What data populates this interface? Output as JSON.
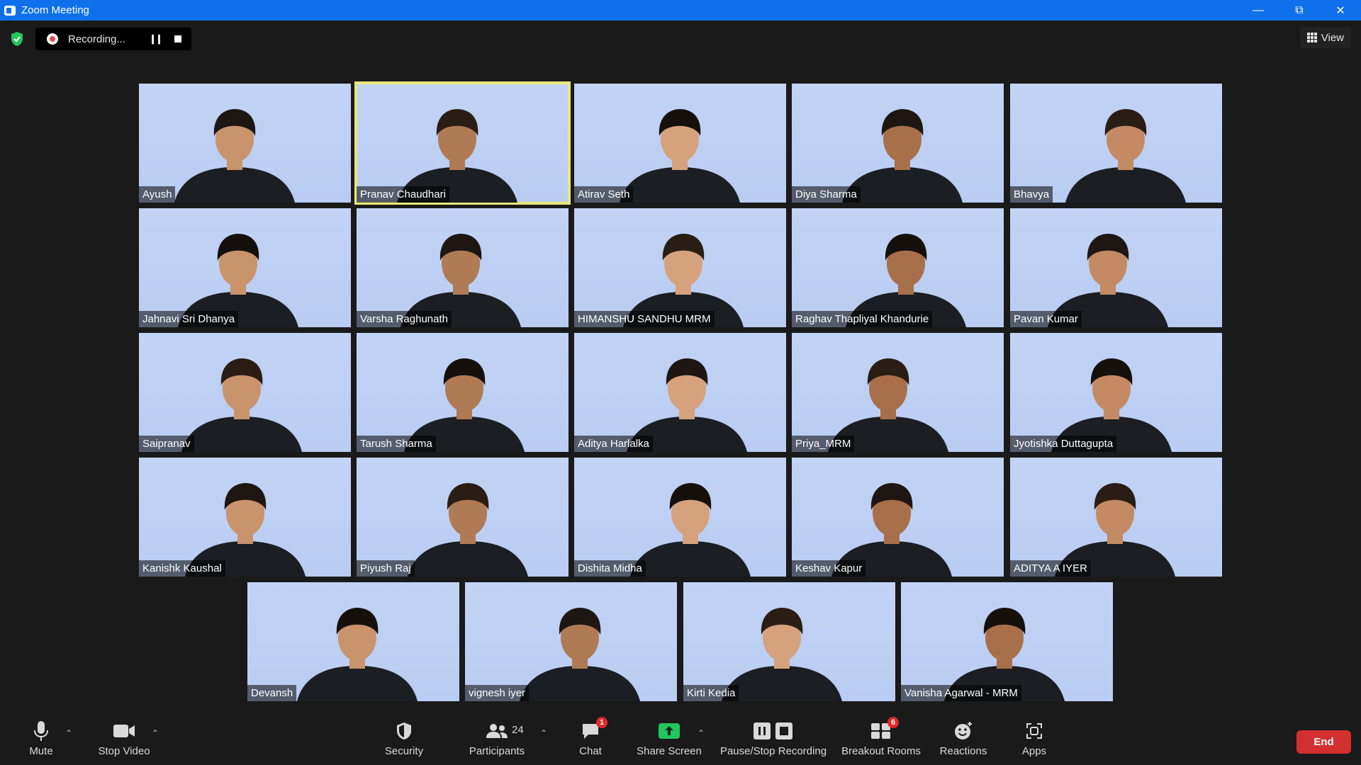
{
  "window": {
    "title": "Zoom Meeting",
    "controls": [
      "minimize",
      "restore",
      "close"
    ]
  },
  "recording": {
    "status": "Recording...",
    "pause_icon": "pause-icon",
    "stop_icon": "stop-icon"
  },
  "view": {
    "label": "View"
  },
  "participants_tiles": [
    {
      "name": "Ayush",
      "active": false
    },
    {
      "name": "Pranav Chaudhari",
      "active": true
    },
    {
      "name": "Atirav Seth",
      "active": false
    },
    {
      "name": "Diya Sharma",
      "active": false
    },
    {
      "name": "Bhavya",
      "active": false
    },
    {
      "name": "Jahnavi Sri Dhanya",
      "active": false
    },
    {
      "name": "Varsha Raghunath",
      "active": false
    },
    {
      "name": "HIMANSHU SANDHU MRM",
      "active": false
    },
    {
      "name": "Raghav Thapliyal Khandurie",
      "active": false
    },
    {
      "name": "Pavan Kumar",
      "active": false
    },
    {
      "name": "Saipranav",
      "active": false
    },
    {
      "name": "Tarush Sharma",
      "active": false
    },
    {
      "name": "Aditya Harlalka",
      "active": false
    },
    {
      "name": "Priya_MRM",
      "active": false
    },
    {
      "name": "Jyotishka Duttagupta",
      "active": false
    },
    {
      "name": "Kanishk Kaushal",
      "active": false
    },
    {
      "name": "Piyush Raj",
      "active": false
    },
    {
      "name": "Dishita Midha",
      "active": false
    },
    {
      "name": "Keshav Kapur",
      "active": false
    },
    {
      "name": "ADITYA A IYER",
      "active": false
    },
    {
      "name": "Devansh",
      "active": false
    },
    {
      "name": "vignesh iyer",
      "active": false
    },
    {
      "name": "Kirti Kedia",
      "active": false
    },
    {
      "name": "Vanisha Agarwal - MRM",
      "active": false
    }
  ],
  "toolbar": {
    "mute": "Mute",
    "stop_video": "Stop Video",
    "security": "Security",
    "participants": "Participants",
    "participants_count": "24",
    "chat": "Chat",
    "chat_badge": "1",
    "share_screen": "Share Screen",
    "pause_stop_recording": "Pause/Stop Recording",
    "breakout_rooms": "Breakout Rooms",
    "breakout_badge": "6",
    "reactions": "Reactions",
    "apps": "Apps",
    "end": "End"
  },
  "colors": {
    "accent": "#0e71eb",
    "share_green": "#22c55e",
    "end_red": "#d32f2f",
    "active_speaker": "#e8e77a"
  }
}
